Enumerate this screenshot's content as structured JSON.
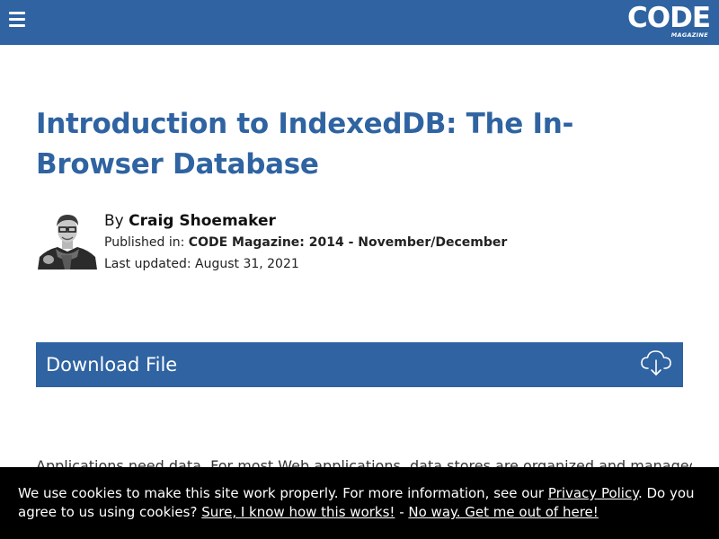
{
  "header": {
    "menu_icon": "hamburger-menu-icon",
    "logo_text": "CODE",
    "logo_subtext": "MAGAZINE",
    "bar_color": "#2f63a1"
  },
  "article": {
    "title": "Introduction to IndexedDB: The In-Browser Database",
    "by_prefix": "By ",
    "author": "Craig Shoemaker",
    "published_prefix": "Published in: ",
    "publication": "CODE Magazine: 2014 - November/December",
    "last_updated": "Last updated: August 31, 2021",
    "intro_text": "Applications need data. For most Web applications, data stores are organized and managed on"
  },
  "download": {
    "label": "Download File",
    "icon": "cloud-download-icon"
  },
  "cookie_banner": {
    "text_1": "We use cookies to make this site work properly. For more information, see our ",
    "privacy_link": "Privacy Policy",
    "text_2": ". Do you agree to us using cookies? ",
    "agree_link": "Sure, I know how this works!",
    "separator": " - ",
    "decline_link": "No way. Get me out of here!"
  },
  "colors": {
    "accent": "#2f63a1",
    "banner": "#000000",
    "text": "#222222"
  }
}
